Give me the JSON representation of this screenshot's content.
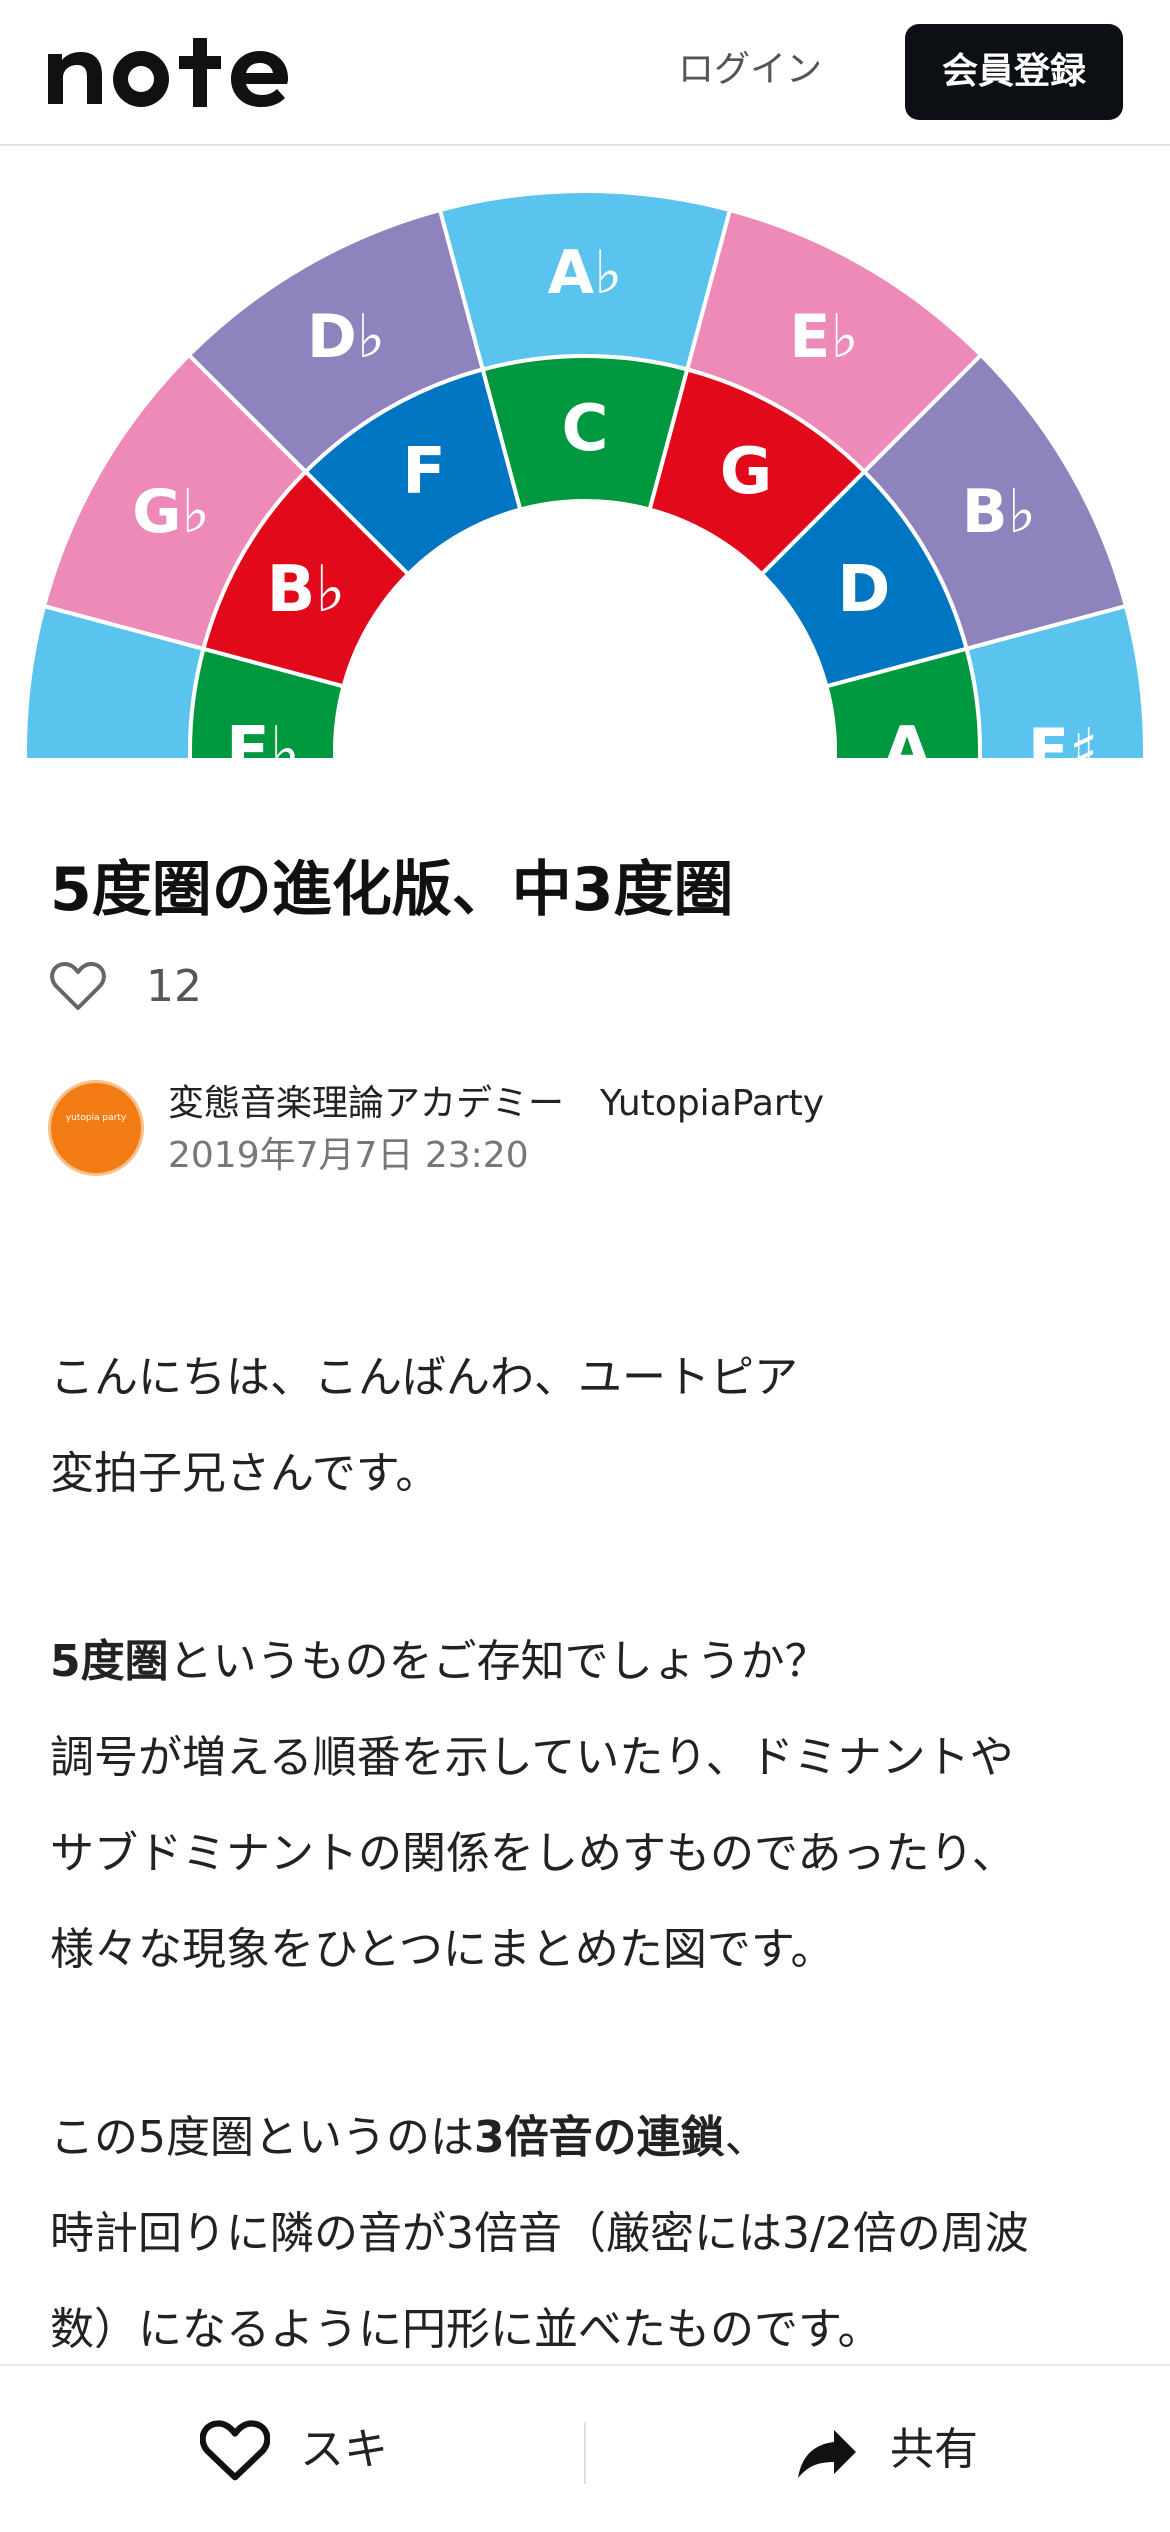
{
  "header": {
    "logo_text": "note",
    "login_label": "ログイン",
    "signup_label": "会員登録"
  },
  "hero": {
    "outer_ring": [
      "G♭",
      "D♭",
      "A♭",
      "E♭",
      "B♭",
      "F♯"
    ],
    "inner_ring": [
      "E♭",
      "B♭",
      "F",
      "C",
      "G",
      "D",
      "A"
    ],
    "colors": {
      "light_blue": "#5bc4ee",
      "pink": "#ee8ab8",
      "purple": "#8f83bd",
      "green": "#00983f",
      "red": "#e2091a",
      "blue": "#0075c2"
    }
  },
  "article": {
    "title": "5度圏の進化版、中3度圏",
    "like_count": "12",
    "author": {
      "avatar_text": "yutopia party",
      "name": "変態音楽理論アカデミー　YutopiaParty",
      "date": "2019年7月7日 23:20"
    },
    "body": {
      "p1_line1": "こんにちは、こんばんわ、ユートピア",
      "p1_line2": "変拍子兄さんです。",
      "p2_bold": "5度圏",
      "p2_line1_rest": "というものをご存知でしょうか？",
      "p2_line2": "調号が増える順番を示していたり、ドミナントや",
      "p2_line3": "サブドミナントの関係をしめすものであったり、",
      "p2_line4": "様々な現象をひとつにまとめた図です。",
      "p3_line1_pre": "この5度圏というのは",
      "p3_bold": "3倍音の連鎖",
      "p3_line1_post": "、",
      "p3_line2": "時計回りに隣の音が3倍音（厳密には3/2倍の周波",
      "p3_line3": "数）になるように円形に並べたものです。"
    }
  },
  "bottom_bar": {
    "like_label": "スキ",
    "share_label": "共有"
  }
}
